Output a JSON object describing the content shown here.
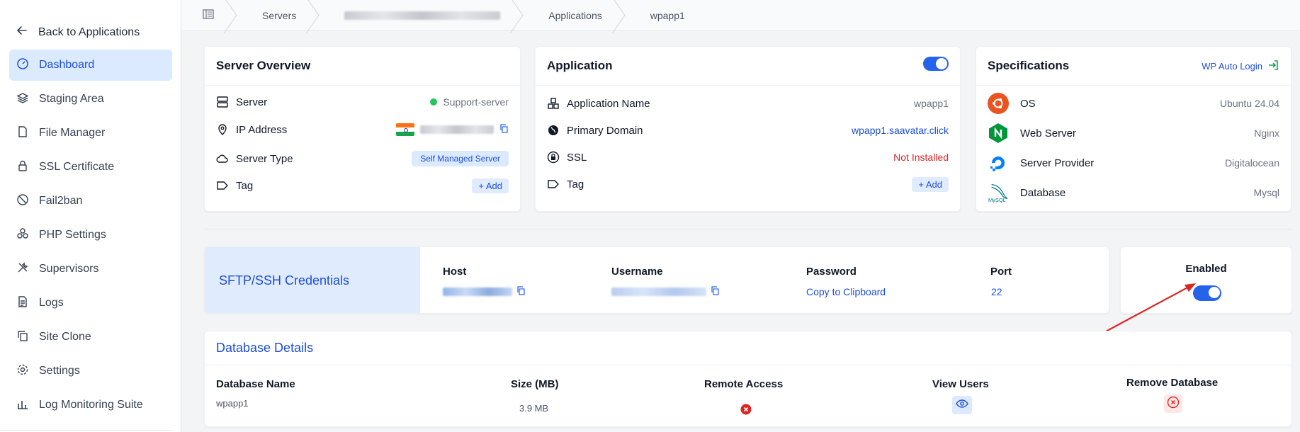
{
  "sidebar": {
    "back_label": "Back to Applications",
    "items": [
      {
        "label": "Dashboard",
        "icon": "gauge-icon"
      },
      {
        "label": "Staging Area",
        "icon": "layers-icon"
      },
      {
        "label": "File Manager",
        "icon": "file-icon"
      },
      {
        "label": "SSL Certificate",
        "icon": "lock-icon"
      },
      {
        "label": "Fail2ban",
        "icon": "ban-icon"
      },
      {
        "label": "PHP Settings",
        "icon": "cubes-icon"
      },
      {
        "label": "Supervisors",
        "icon": "tools-icon"
      },
      {
        "label": "Logs",
        "icon": "document-icon"
      },
      {
        "label": "Site Clone",
        "icon": "copy-icon"
      },
      {
        "label": "Settings",
        "icon": "gear-icon"
      },
      {
        "label": "Log Monitoring Suite",
        "icon": "bar-chart-icon"
      }
    ]
  },
  "breadcrumb": {
    "servers": "Servers",
    "applications": "Applications",
    "current": "wpapp1"
  },
  "server_overview": {
    "title": "Server Overview",
    "server_label": "Server",
    "server_value": "Support-server",
    "ip_label": "IP Address",
    "type_label": "Server Type",
    "type_value": "Self Managed Server",
    "tag_label": "Tag",
    "add_label": "+ Add"
  },
  "application": {
    "title": "Application",
    "name_label": "Application Name",
    "name_value": "wpapp1",
    "domain_label": "Primary Domain",
    "domain_value": "wpapp1.saavatar.click",
    "ssl_label": "SSL",
    "ssl_value": "Not Installed",
    "tag_label": "Tag",
    "add_label": "+ Add",
    "enabled": true
  },
  "specifications": {
    "title": "Specifications",
    "wp_login": "WP Auto Login",
    "os_label": "OS",
    "os_value": "Ubuntu 24.04",
    "web_label": "Web Server",
    "web_value": "Nginx",
    "provider_label": "Server Provider",
    "provider_value": "Digitalocean",
    "db_label": "Database",
    "db_value": "Mysql",
    "mysql_logo_text": "MySQL"
  },
  "credentials": {
    "title": "SFTP/SSH Credentials",
    "host_label": "Host",
    "username_label": "Username",
    "password_label": "Password",
    "password_action": "Copy to Clipboard",
    "port_label": "Port",
    "port_value": "22",
    "enabled_label": "Enabled",
    "enabled": true
  },
  "database": {
    "title": "Database Details",
    "headers": {
      "name": "Database Name",
      "size": "Size (MB)",
      "remote": "Remote Access",
      "users": "View Users",
      "remove": "Remove Database"
    },
    "row": {
      "name": "wpapp1",
      "size": "3.9 MB"
    }
  },
  "colors": {
    "accent": "#2563eb",
    "active_bg": "#dbeafe",
    "danger": "#dc2626",
    "success": "#22c55e"
  }
}
